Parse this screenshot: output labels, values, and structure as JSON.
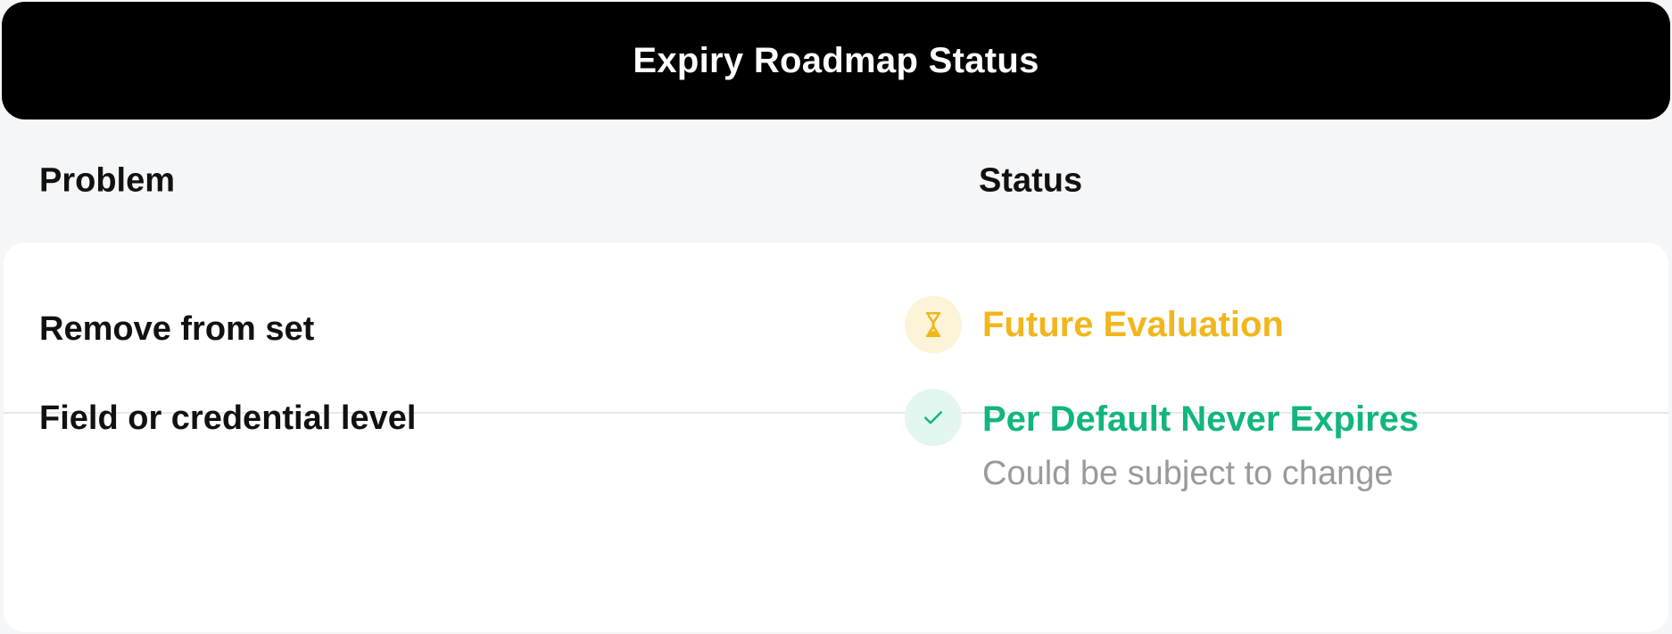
{
  "title": "Expiry Roadmap Status",
  "columns": {
    "problem": "Problem",
    "status": "Status"
  },
  "rows": [
    {
      "problem": "Remove from set",
      "status": {
        "label": "Future Evaluation",
        "icon": "hourglass-icon",
        "color": "#f2b61d",
        "icon_bg": "#fdf4d8"
      }
    },
    {
      "problem": "Field or credential level",
      "status": {
        "label": "Per Default Never Expires",
        "note": "Could be subject to change",
        "icon": "check-icon",
        "color": "#12b57f",
        "icon_bg": "#e3f6ef"
      }
    }
  ],
  "colors": {
    "title_bg": "#000000",
    "title_text": "#ffffff",
    "page_bg": "#f5f6f8",
    "row_bg": "#ffffff",
    "note_text": "#9a9a9a"
  }
}
